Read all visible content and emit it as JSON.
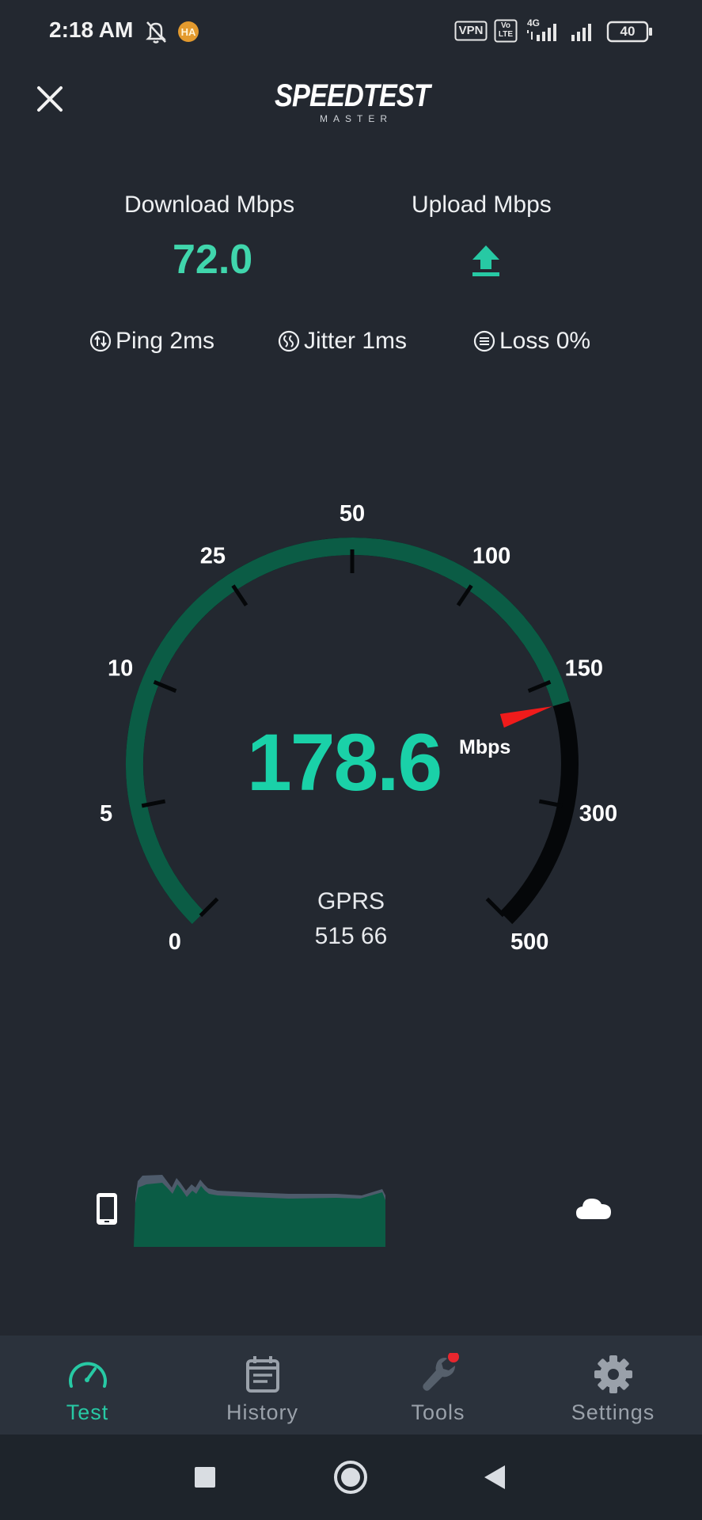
{
  "status_bar": {
    "time": "2:18 AM",
    "mute_icon": "bell-off-icon",
    "app_badge_icon": "ha-badge-icon",
    "vpn_label": "VPN",
    "volte_label": "Vo LTE",
    "network_label": "4G",
    "battery_level": "40"
  },
  "header": {
    "close_icon": "close-icon",
    "logo_main": "SPEEDTEST",
    "logo_sub": "MASTER"
  },
  "metrics": {
    "download_label": "Download Mbps",
    "download_value": "72.0",
    "upload_label": "Upload Mbps",
    "upload_icon": "upload-arrow-icon"
  },
  "stats": {
    "ping": "Ping 2ms",
    "jitter": "Jitter 1ms",
    "loss": "Loss 0%"
  },
  "gauge": {
    "tick_labels": [
      "0",
      "5",
      "10",
      "25",
      "50",
      "100",
      "150",
      "300",
      "500"
    ],
    "current_value": "178.6",
    "unit": "Mbps",
    "network_type": "GPRS",
    "network_code": "515 66",
    "colors": {
      "progress": "#0b5c45",
      "track": "#050709",
      "needle": "#f01b1b",
      "value_text": "#1ad1a8"
    }
  },
  "graph": {
    "phone_icon": "phone-icon",
    "cloud_icon": "cloud-icon",
    "fill_color": "#0b5c45"
  },
  "bottom_nav": {
    "items": [
      {
        "label": "Test",
        "icon": "speedometer-icon",
        "active": true
      },
      {
        "label": "History",
        "icon": "calendar-icon",
        "active": false
      },
      {
        "label": "Tools",
        "icon": "wrench-icon",
        "active": false
      },
      {
        "label": "Settings",
        "icon": "gear-icon",
        "active": false
      }
    ],
    "accent_color": "#27c9a4",
    "notification_dot_color": "#e8262e"
  },
  "system_nav": {
    "recents_icon": "square-icon",
    "home_icon": "circle-icon",
    "back_icon": "triangle-back-icon"
  }
}
